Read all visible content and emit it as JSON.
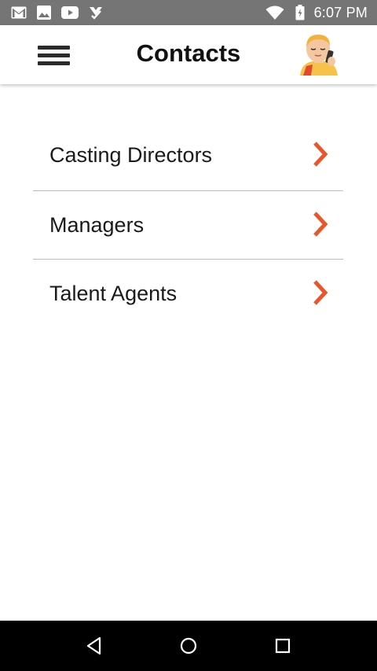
{
  "status_bar": {
    "time": "6:07 PM",
    "left_icons": [
      "gmail-icon",
      "photos-icon",
      "youtube-icon",
      "task-check-icon"
    ],
    "right_icons": [
      "wifi-icon",
      "battery-charging-icon"
    ]
  },
  "app_bar": {
    "title": "Contacts",
    "menu_icon": "hamburger-menu-icon",
    "avatar_icon": "person-on-phone-avatar"
  },
  "contacts": {
    "items": [
      {
        "label": "Casting Directors"
      },
      {
        "label": "Managers"
      },
      {
        "label": "Talent Agents"
      }
    ],
    "chevron_color": "#e8562a"
  },
  "nav_bar": {
    "buttons": [
      "back-icon",
      "home-icon",
      "recents-icon"
    ]
  },
  "colors": {
    "status_bar": "#757575",
    "accent": "#e8562a",
    "divider": "#bdbdbd",
    "nav_bar": "#000000"
  }
}
